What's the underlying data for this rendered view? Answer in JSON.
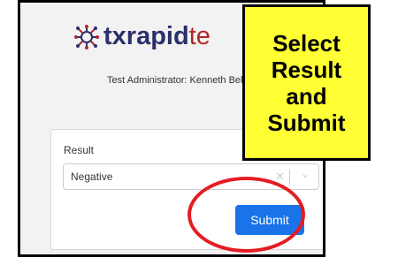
{
  "logo": {
    "part1": "tx",
    "part2": "rapid",
    "part3": "te",
    "icon": "virus-network-icon"
  },
  "header": {
    "admin_text": "Test Administrator: Kenneth Bell"
  },
  "form": {
    "label": "Result",
    "selected_value": "Negative",
    "clear_icon": "✕",
    "chevron_icon": "⌄",
    "submit_label": "Submit"
  },
  "callout": {
    "line1": "Select",
    "line2": "Result",
    "line3": "and",
    "line4": "Submit"
  },
  "colors": {
    "brand_navy": "#2b2f6b",
    "brand_red": "#b2262a",
    "button_blue": "#1a73e8",
    "callout_yellow": "#ffff33",
    "highlight_red": "#e51c23"
  }
}
